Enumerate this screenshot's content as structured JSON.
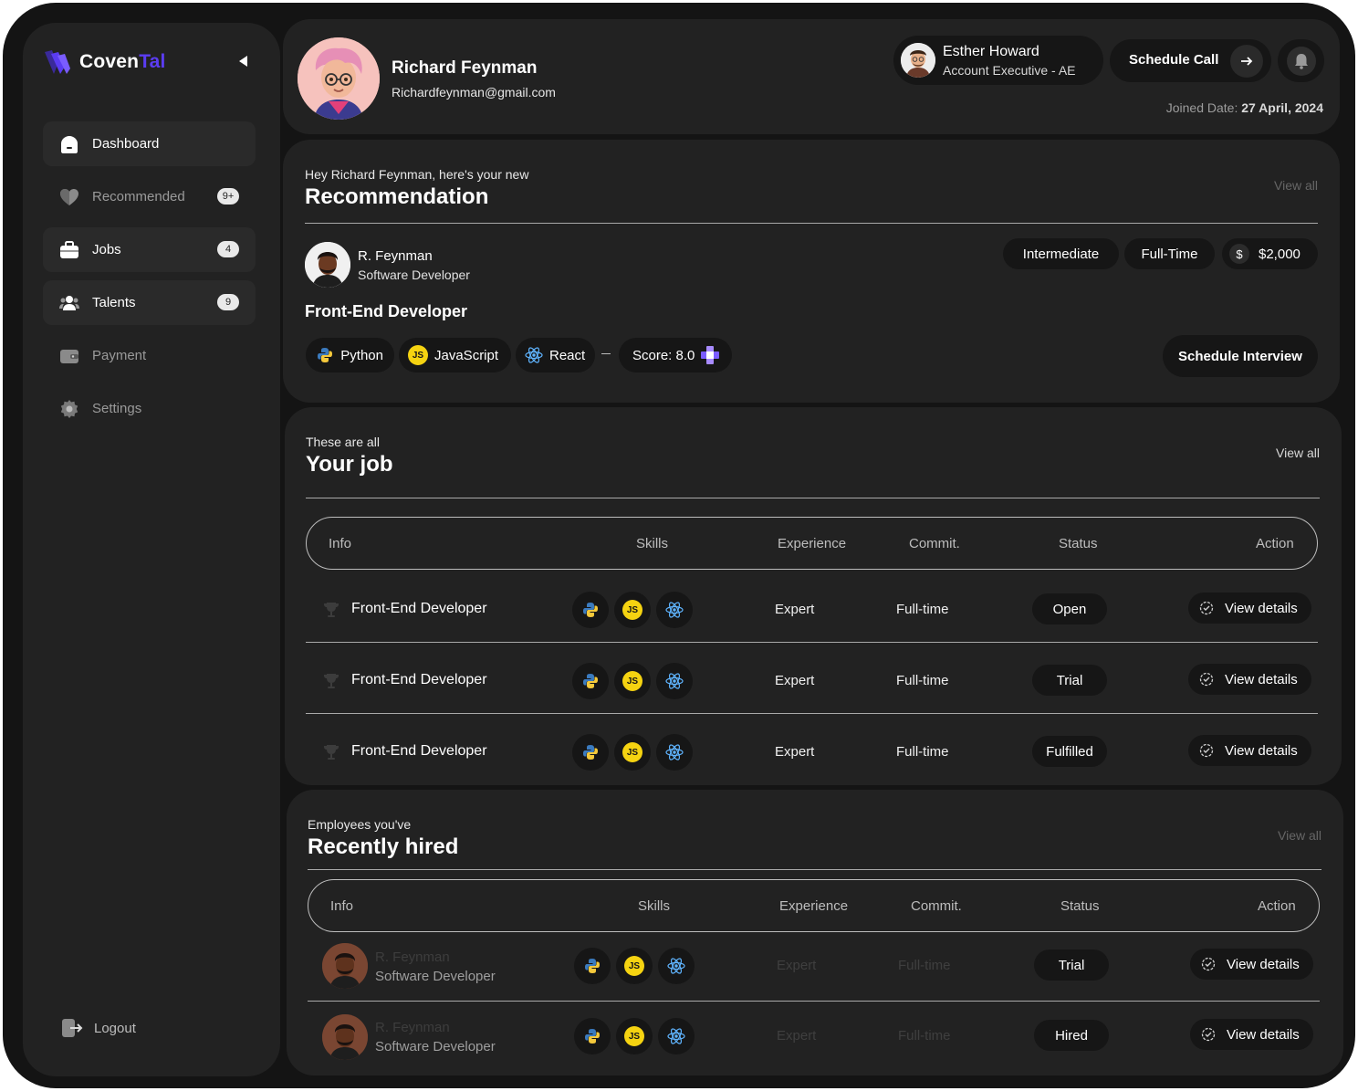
{
  "app": {
    "logo_a": "Coven",
    "logo_b": "Tal"
  },
  "sidebar": {
    "items": [
      {
        "label": "Dashboard",
        "badge": ""
      },
      {
        "label": "Recommended",
        "badge": "9+"
      },
      {
        "label": "Jobs",
        "badge": "4"
      },
      {
        "label": "Talents",
        "badge": "9"
      },
      {
        "label": "Payment",
        "badge": ""
      },
      {
        "label": "Settings",
        "badge": ""
      }
    ],
    "logout": "Logout"
  },
  "header": {
    "name": "Richard Feynman",
    "email": "Richardfeynman@gmail.com",
    "ae_name": "Esther Howard",
    "ae_role": "Account Executive - AE",
    "schedule_call": "Schedule Call",
    "joined_label": "Joined Date:",
    "joined_value": "27 April, 2024"
  },
  "recommendation": {
    "subtitle": "Hey Richard Feynman, here's your new",
    "title": "Recommendation",
    "view_all": "View all",
    "person_name": "R. Feynman",
    "person_role": "Software Developer",
    "tags": [
      "Intermediate",
      "Full-Time",
      "$2,000"
    ],
    "dollar": "$",
    "job_title": "Front-End Developer",
    "skills": [
      "Python",
      "JavaScript",
      "React"
    ],
    "score": "Score: 8.0",
    "schedule_interview": "Schedule Interview"
  },
  "jobs": {
    "subtitle": "These are all",
    "title": "Your job",
    "view_all": "View all",
    "columns": [
      "Info",
      "Skills",
      "Experience",
      "Commit.",
      "Status",
      "Action"
    ],
    "rows": [
      {
        "title": "Front-End Developer",
        "experience": "Expert",
        "commit": "Full-time",
        "status": "Open",
        "action": "View details"
      },
      {
        "title": "Front-End Developer",
        "experience": "Expert",
        "commit": "Full-time",
        "status": "Trial",
        "action": "View details"
      },
      {
        "title": "Front-End Developer",
        "experience": "Expert",
        "commit": "Full-time",
        "status": "Fulfilled",
        "action": "View details"
      }
    ]
  },
  "hired": {
    "subtitle": "Employees you've",
    "title": "Recently hired",
    "view_all": "View all",
    "columns": [
      "Info",
      "Skills",
      "Experience",
      "Commit.",
      "Status",
      "Action"
    ],
    "rows": [
      {
        "name": "R. Feynman",
        "role": "Software Developer",
        "experience": "Expert",
        "commit": "Full-time",
        "status": "Trial",
        "action": "View details"
      },
      {
        "name": "R. Feynman",
        "role": "Software Developer",
        "experience": "Expert",
        "commit": "Full-time",
        "status": "Hired",
        "action": "View details"
      }
    ]
  },
  "skill_icons": {
    "js_glyph": "JS"
  },
  "colors": {
    "accent": "#5b3cf2",
    "bg": "#141414",
    "card": "#222222",
    "pill": "#161616"
  }
}
